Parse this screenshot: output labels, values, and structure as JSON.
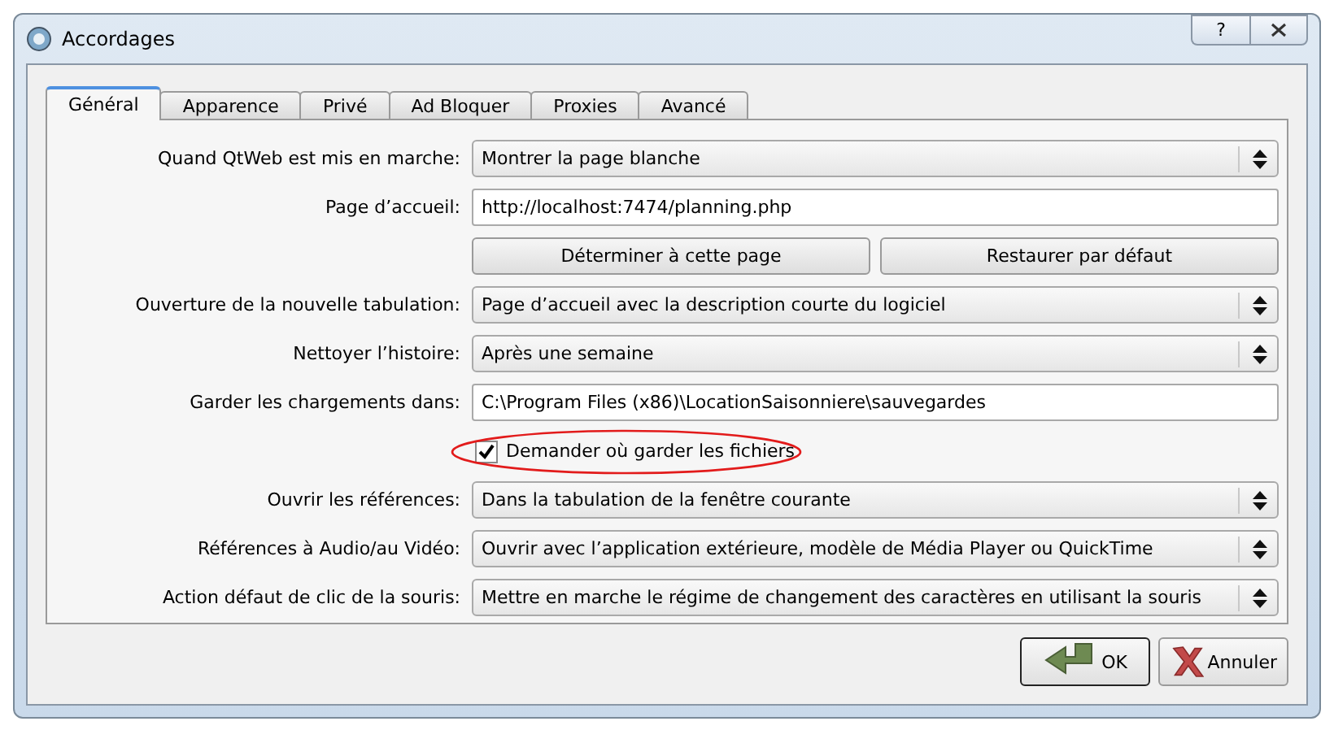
{
  "window": {
    "title": "Accordages",
    "help": "?"
  },
  "tabs": [
    {
      "label": "Général",
      "selected": true
    },
    {
      "label": "Apparence",
      "selected": false
    },
    {
      "label": "Privé",
      "selected": false
    },
    {
      "label": "Ad Bloquer",
      "selected": false
    },
    {
      "label": "Proxies",
      "selected": false
    },
    {
      "label": "Avancé",
      "selected": false
    }
  ],
  "rows": [
    {
      "kind": "select",
      "label": "Quand QtWeb est mis en marche:",
      "value": "Montrer la page blanche"
    },
    {
      "kind": "input",
      "label": "Page d’accueil:",
      "value": "http://localhost:7474/planning.php"
    },
    {
      "kind": "buttons",
      "buttons": [
        "Déterminer à cette page",
        "Restaurer par défaut"
      ]
    },
    {
      "kind": "select",
      "label": "Ouverture de la nouvelle tabulation:",
      "value": "Page d’accueil avec la description courte du logiciel"
    },
    {
      "kind": "select",
      "label": "Nettoyer l’histoire:",
      "value": "Après une semaine"
    },
    {
      "kind": "input",
      "label": "Garder les chargements dans:",
      "value": "C:\\Program Files (x86)\\LocationSaisonniere\\sauvegardes"
    },
    {
      "kind": "checkbox",
      "label": "Demander où garder les fichiers",
      "checked": true,
      "circled": true
    },
    {
      "kind": "select",
      "label": "Ouvrir les références:",
      "value": "Dans la tabulation de la fenêtre courante"
    },
    {
      "kind": "select",
      "label": "Références à Audio/au Vidéo:",
      "value": "Ouvrir avec l’application extérieure, modèle de Média Player ou QuickTime"
    },
    {
      "kind": "select",
      "label": "Action défaut de clic de la souris:",
      "value": "Mettre en marche le régime de changement des caractères en utilisant la souris"
    }
  ],
  "footer": [
    {
      "kind": "ok",
      "label": "OK"
    },
    {
      "kind": "cancel",
      "label": "Annuler"
    }
  ]
}
